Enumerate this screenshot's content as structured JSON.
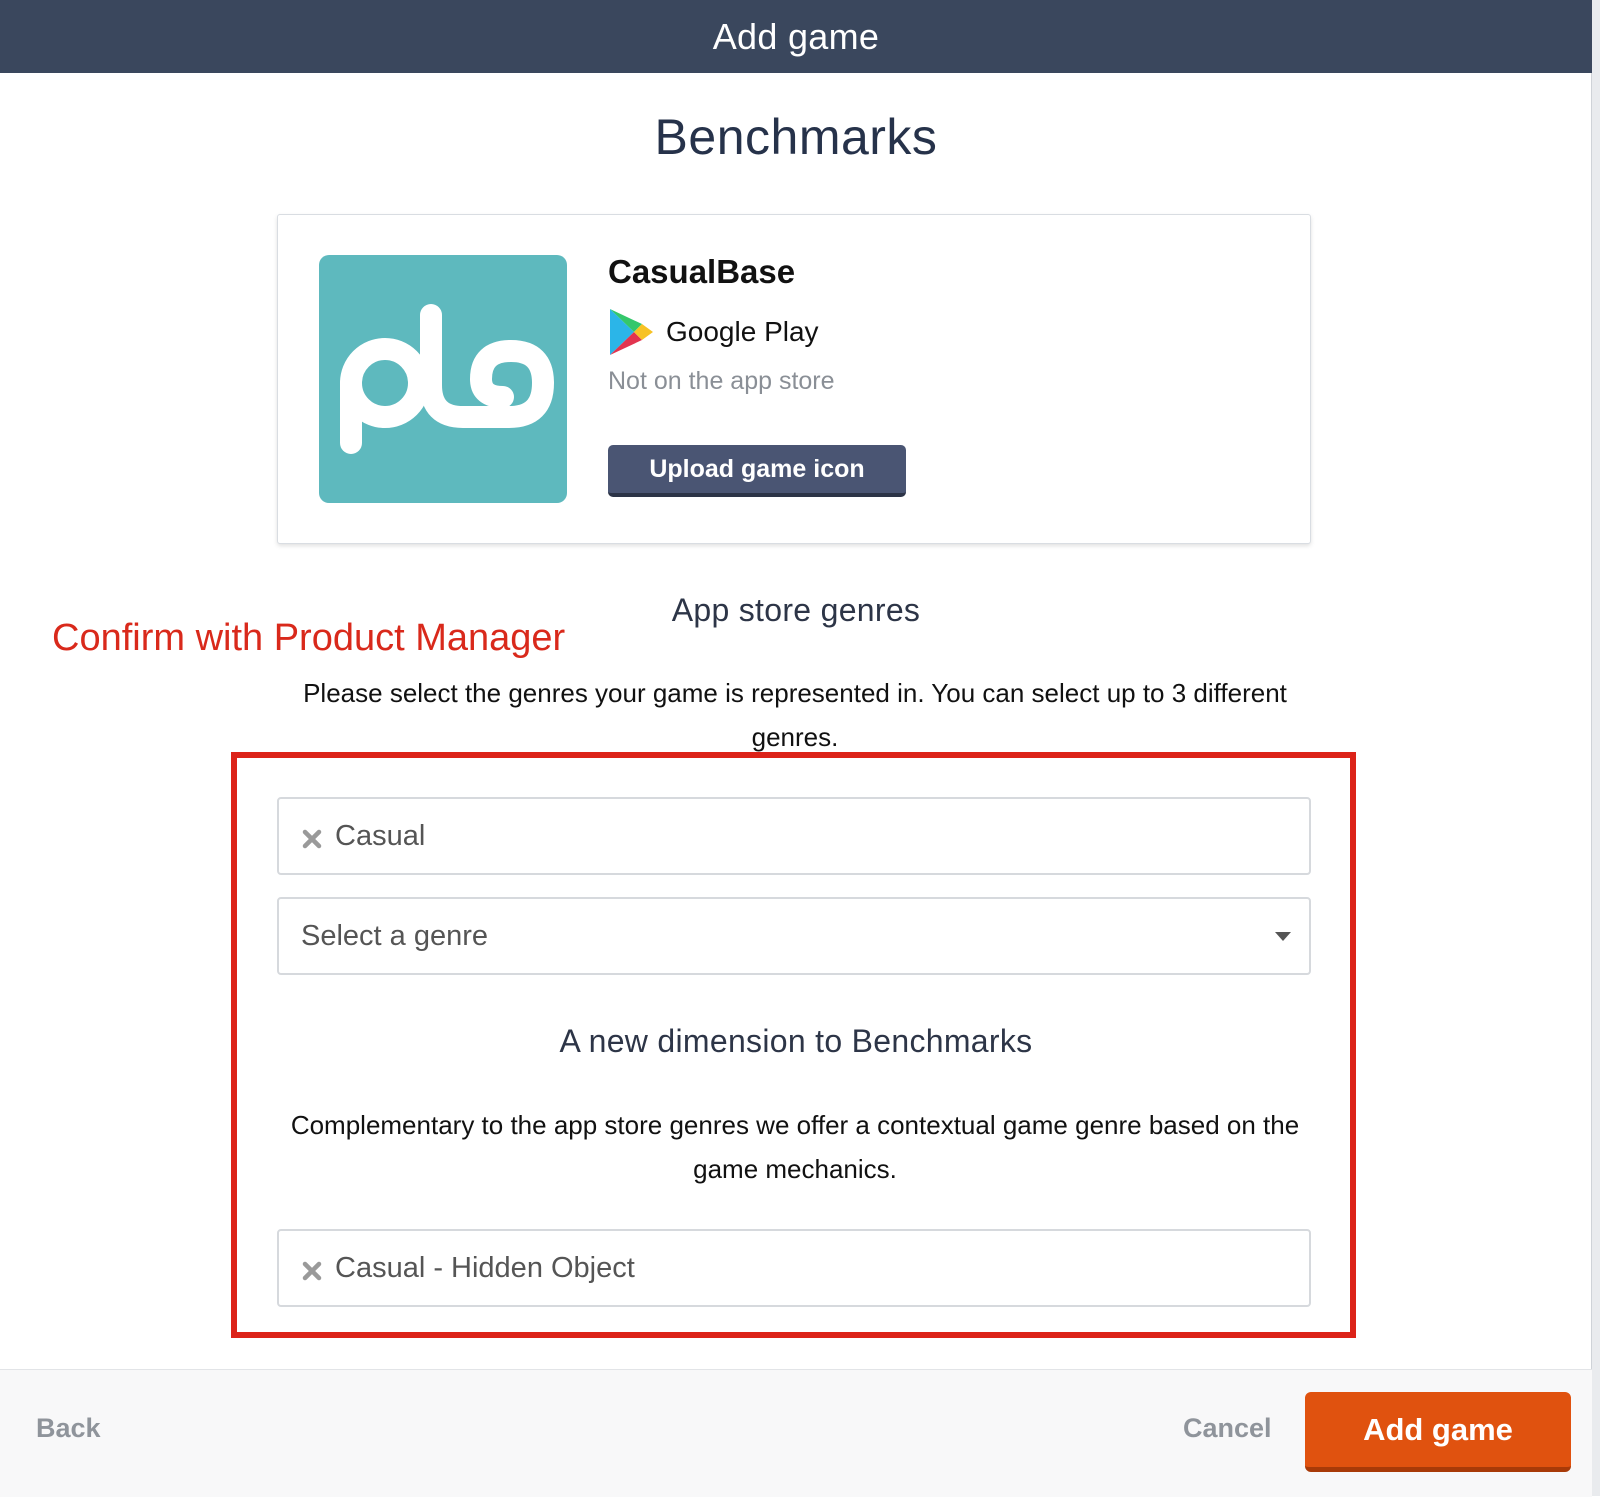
{
  "modal": {
    "title": "Add game"
  },
  "page": {
    "title": "Benchmarks"
  },
  "game": {
    "name": "CasualBase",
    "store": "Google Play",
    "store_status": "Not on the app store",
    "upload_button": "Upload game icon",
    "icon_name": "app-logo-icon",
    "icon_color": "#5eb9be"
  },
  "app_store_genres": {
    "title": "App store genres",
    "description": "Please select the genres your game is represented in. You can select up to 3 different genres.",
    "selected": [
      "Casual"
    ],
    "select_placeholder": "Select a genre"
  },
  "annotation": {
    "text": "Confirm with Product Manager",
    "color": "#dc2319"
  },
  "dimension": {
    "title": "A new dimension to Benchmarks",
    "description": "Complementary to the app store genres we offer a contextual game genre based on the game mechanics.",
    "selected": [
      "Casual - Hidden Object"
    ]
  },
  "footer": {
    "back": "Back",
    "cancel": "Cancel",
    "submit": "Add game",
    "submit_color": "#e0520f"
  }
}
